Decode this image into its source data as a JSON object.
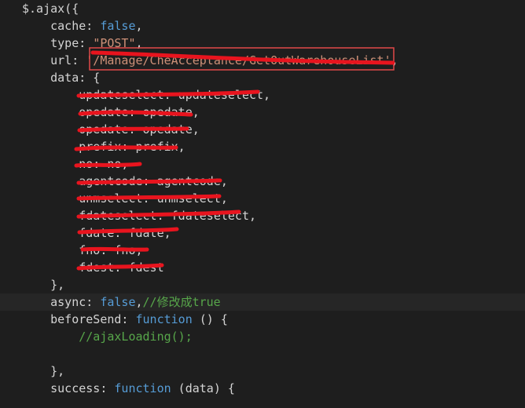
{
  "lines": [
    [
      {
        "t": "$.ajax({",
        "c": "plain"
      }
    ],
    [
      {
        "t": "    cache: ",
        "c": "key"
      },
      {
        "t": "false",
        "c": "kw"
      },
      {
        "t": ",",
        "c": "plain"
      }
    ],
    [
      {
        "t": "    type: ",
        "c": "key"
      },
      {
        "t": "\"POST\"",
        "c": "str"
      },
      {
        "t": ",",
        "c": "plain"
      }
    ],
    [
      {
        "t": "    url: ",
        "c": "key"
      },
      {
        "t": "'/Manage/CheAcceptance/GetOutWarehouseList'",
        "c": "str"
      },
      {
        "t": ",",
        "c": "plain"
      }
    ],
    [
      {
        "t": "    data: {",
        "c": "key"
      }
    ],
    [
      {
        "t": "        updateselect: updateselect,",
        "c": "plain"
      }
    ],
    [
      {
        "t": "        opedate: opedate,",
        "c": "plain"
      }
    ],
    [
      {
        "t": "        opedate: opedate,",
        "c": "plain"
      }
    ],
    [
      {
        "t": "        prefix: prefix,",
        "c": "plain"
      }
    ],
    [
      {
        "t": "        no: no,",
        "c": "plain"
      }
    ],
    [
      {
        "t": "        agentcode: agentcode,",
        "c": "plain"
      }
    ],
    [
      {
        "t": "        unmselect: unmselect,",
        "c": "plain"
      }
    ],
    [
      {
        "t": "        fdateselect: fdateselect,",
        "c": "plain"
      }
    ],
    [
      {
        "t": "        fdate: fdate,",
        "c": "plain"
      }
    ],
    [
      {
        "t": "        fno: fno,",
        "c": "plain"
      }
    ],
    [
      {
        "t": "        fdest: fdest",
        "c": "plain"
      }
    ],
    [
      {
        "t": "    },",
        "c": "plain"
      }
    ],
    [
      {
        "t": "    async: ",
        "c": "key"
      },
      {
        "t": "false",
        "c": "kw"
      },
      {
        "t": ",",
        "c": "plain"
      },
      {
        "t": "//修改成true",
        "c": "cmt"
      }
    ],
    [
      {
        "t": "    beforeSend: ",
        "c": "key"
      },
      {
        "t": "function",
        "c": "kw"
      },
      {
        "t": " () {",
        "c": "plain"
      }
    ],
    [
      {
        "t": "        //ajaxLoading();",
        "c": "cmt"
      }
    ],
    [
      {
        "t": "",
        "c": "plain"
      }
    ],
    [
      {
        "t": "    },",
        "c": "plain"
      }
    ],
    [
      {
        "t": "    success: ",
        "c": "key"
      },
      {
        "t": "function",
        "c": "kw"
      },
      {
        "t": " (data) {",
        "c": "plain"
      }
    ]
  ],
  "current_line_index": 17,
  "highlight_box_color": "#e04848",
  "scribble_color": "#e8141e",
  "colors": {
    "background": "#1e1e1e",
    "keyword": "#569cd6",
    "string": "#ce9178",
    "comment": "#57a64a",
    "text": "#d4d4d4"
  }
}
